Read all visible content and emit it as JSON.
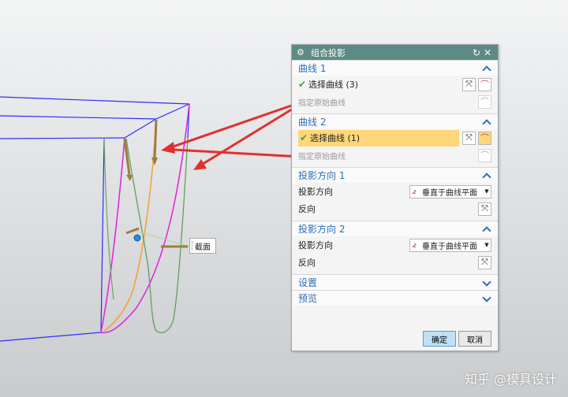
{
  "dialog": {
    "title": "组合投影",
    "groups": {
      "curve1": {
        "label": "曲线 1",
        "select": "选择曲线 (3)",
        "original": "指定原始曲线"
      },
      "curve2": {
        "label": "曲线 2",
        "select": "选择曲线 (1)",
        "original": "指定原始曲线"
      },
      "dir1": {
        "label": "投影方向 1",
        "proj_label": "投影方向",
        "proj_value": "垂直于曲线平面",
        "reverse_label": "反向"
      },
      "dir2": {
        "label": "投影方向 2",
        "proj_label": "投影方向",
        "proj_value": "垂直于曲线平面",
        "reverse_label": "反向"
      },
      "settings": {
        "label": "设置"
      },
      "preview": {
        "label": "预览"
      }
    },
    "ok_label": "确定",
    "cancel_label": "取消"
  },
  "viewport": {
    "section_label": "截面"
  },
  "watermark": "知乎 @模具设计",
  "colors": {
    "titlebar": "#5e8a84",
    "group_header": "#2e6fb8",
    "selected_row": "#fdd77a",
    "edge_blue": "#2d2dff",
    "curve_magenta": "#e020e0",
    "curve_orange": "#f5a030",
    "curve_green": "#5fa05f",
    "arrow_red": "#e03030"
  }
}
